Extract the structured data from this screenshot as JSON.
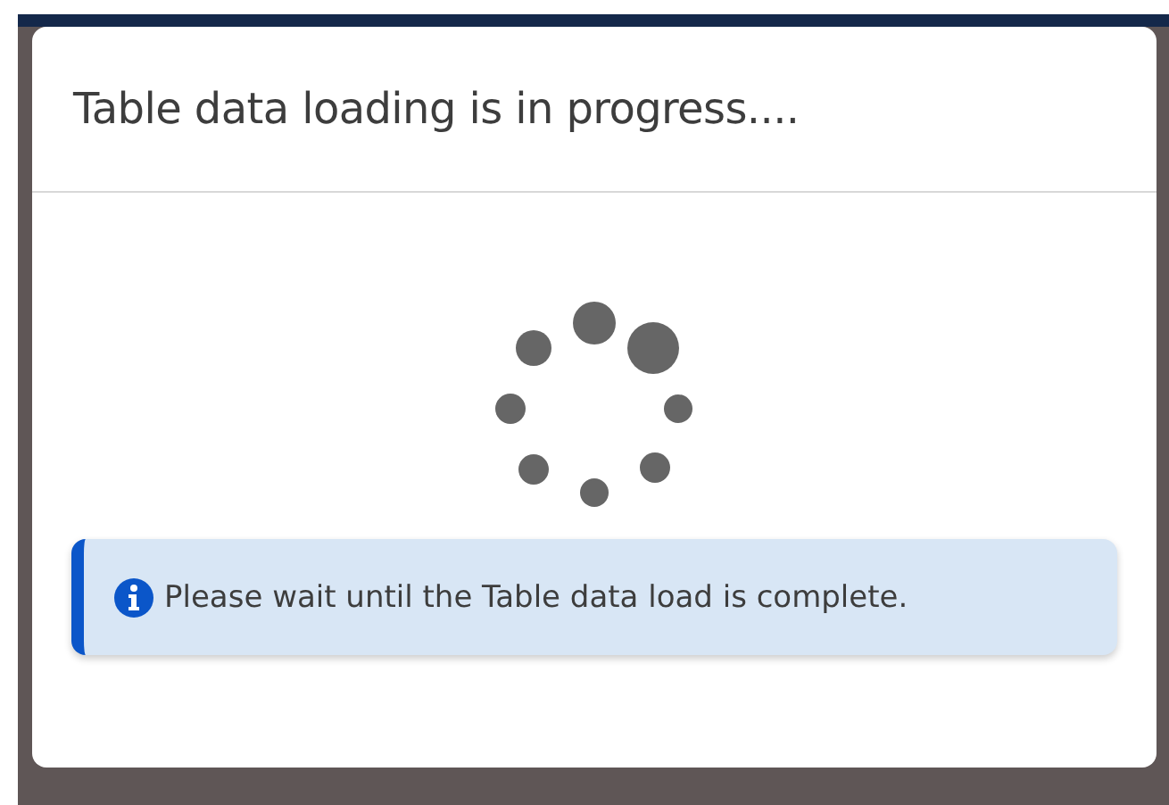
{
  "dialog": {
    "title": "Table data loading is in progress....",
    "alert": {
      "kind": "info",
      "message": "Please wait until the Table data load is complete."
    }
  }
}
